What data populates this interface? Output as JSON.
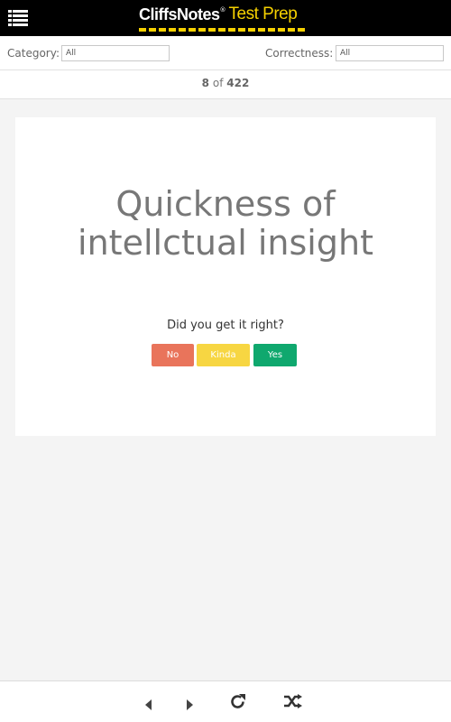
{
  "header": {
    "brand_main": "CliffsNotes",
    "brand_reg": "®",
    "brand_sub": "Test Prep",
    "menu_icon": "hamburger-list-icon",
    "brand_color": "#f5d000"
  },
  "filters": {
    "category_label": "Category:",
    "category_value": "All",
    "correctness_label": "Correctness:",
    "correctness_value": "All"
  },
  "counter": {
    "current": "8",
    "separator": "of",
    "total": "422"
  },
  "card": {
    "term": "Quickness of intellctual insight",
    "question": "Did you get it right?",
    "buttons": {
      "no": "No",
      "kinda": "Kinda",
      "yes": "Yes"
    },
    "colors": {
      "no": "#e9745b",
      "kinda": "#f7d642",
      "yes": "#0fa86e"
    }
  },
  "bottom_nav": {
    "icons": [
      "previous-icon",
      "next-icon",
      "refresh-icon",
      "shuffle-icon"
    ]
  }
}
